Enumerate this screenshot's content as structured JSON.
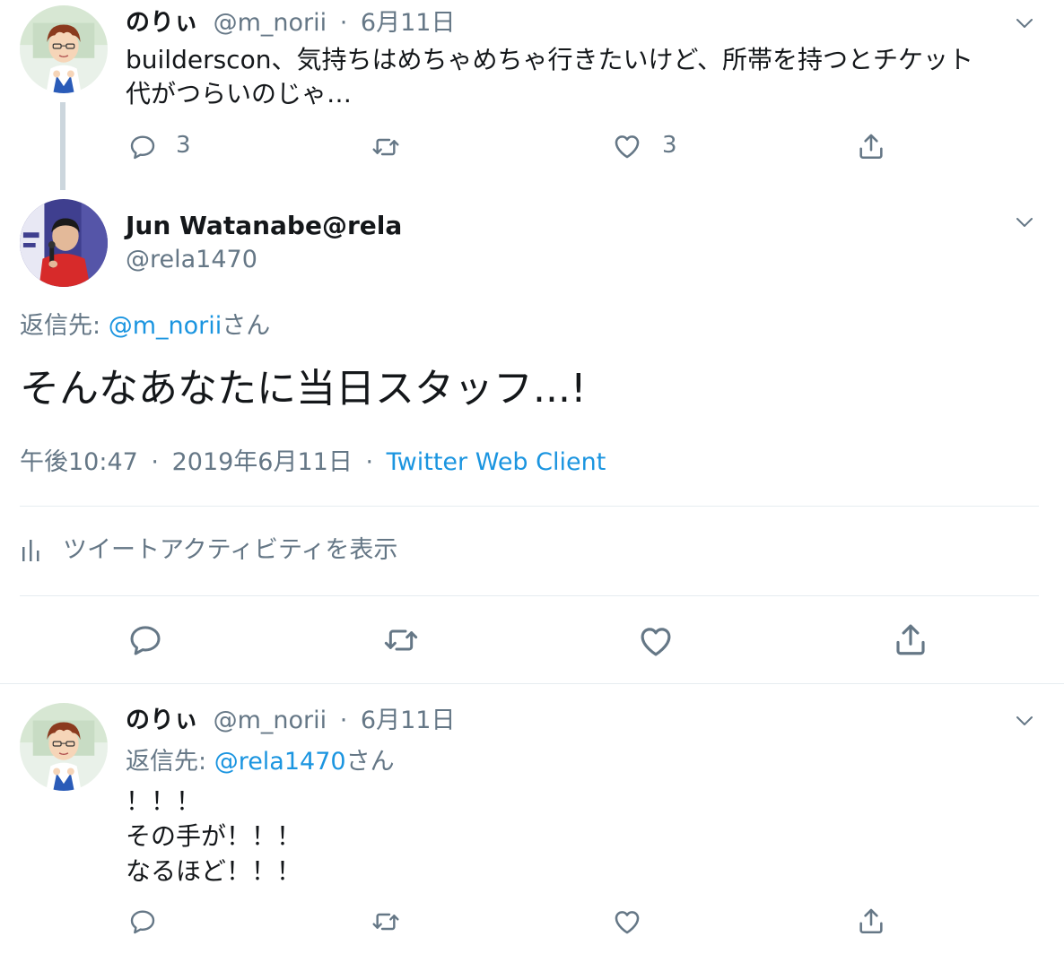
{
  "tweet1": {
    "display_name": "のりぃ",
    "handle": "@m_norii",
    "sep": "·",
    "date": "6月11日",
    "text_line1": "builderscon、気持ちはめちゃめちゃ行きたいけど、所帯を持つとチケット",
    "text_line2": "代がつらいのじゃ…",
    "reply_count": "3",
    "like_count": "3"
  },
  "main": {
    "display_name": "Jun Watanabe@rela",
    "handle": "@rela1470",
    "reply_prefix": "返信先: ",
    "reply_to": "@m_norii",
    "reply_suffix": "さん",
    "text": "そんなあなたに当日スタッフ...!",
    "time": "午後10:47",
    "sep1": "·",
    "date": "2019年6月11日",
    "sep2": "·",
    "client": "Twitter Web Client",
    "activity": "ツイートアクティビティを表示"
  },
  "tweet3": {
    "display_name": "のりぃ",
    "handle": "@m_norii",
    "sep": "·",
    "date": "6月11日",
    "reply_prefix": "返信先: ",
    "reply_to": "@rela1470",
    "reply_suffix": "さん",
    "line1": "！！！",
    "line2": "その手が！！！",
    "line3": "なるほど！！！"
  },
  "icons": {
    "reply": "reply-icon",
    "retweet": "retweet-icon",
    "like": "heart-icon",
    "share": "share-icon",
    "caret": "chevron-down-icon",
    "analytics": "analytics-icon"
  },
  "colors": {
    "link": "#1b95e0",
    "muted": "#657786",
    "divider": "#e6ecf0",
    "thread_line": "#ccd6dd"
  }
}
